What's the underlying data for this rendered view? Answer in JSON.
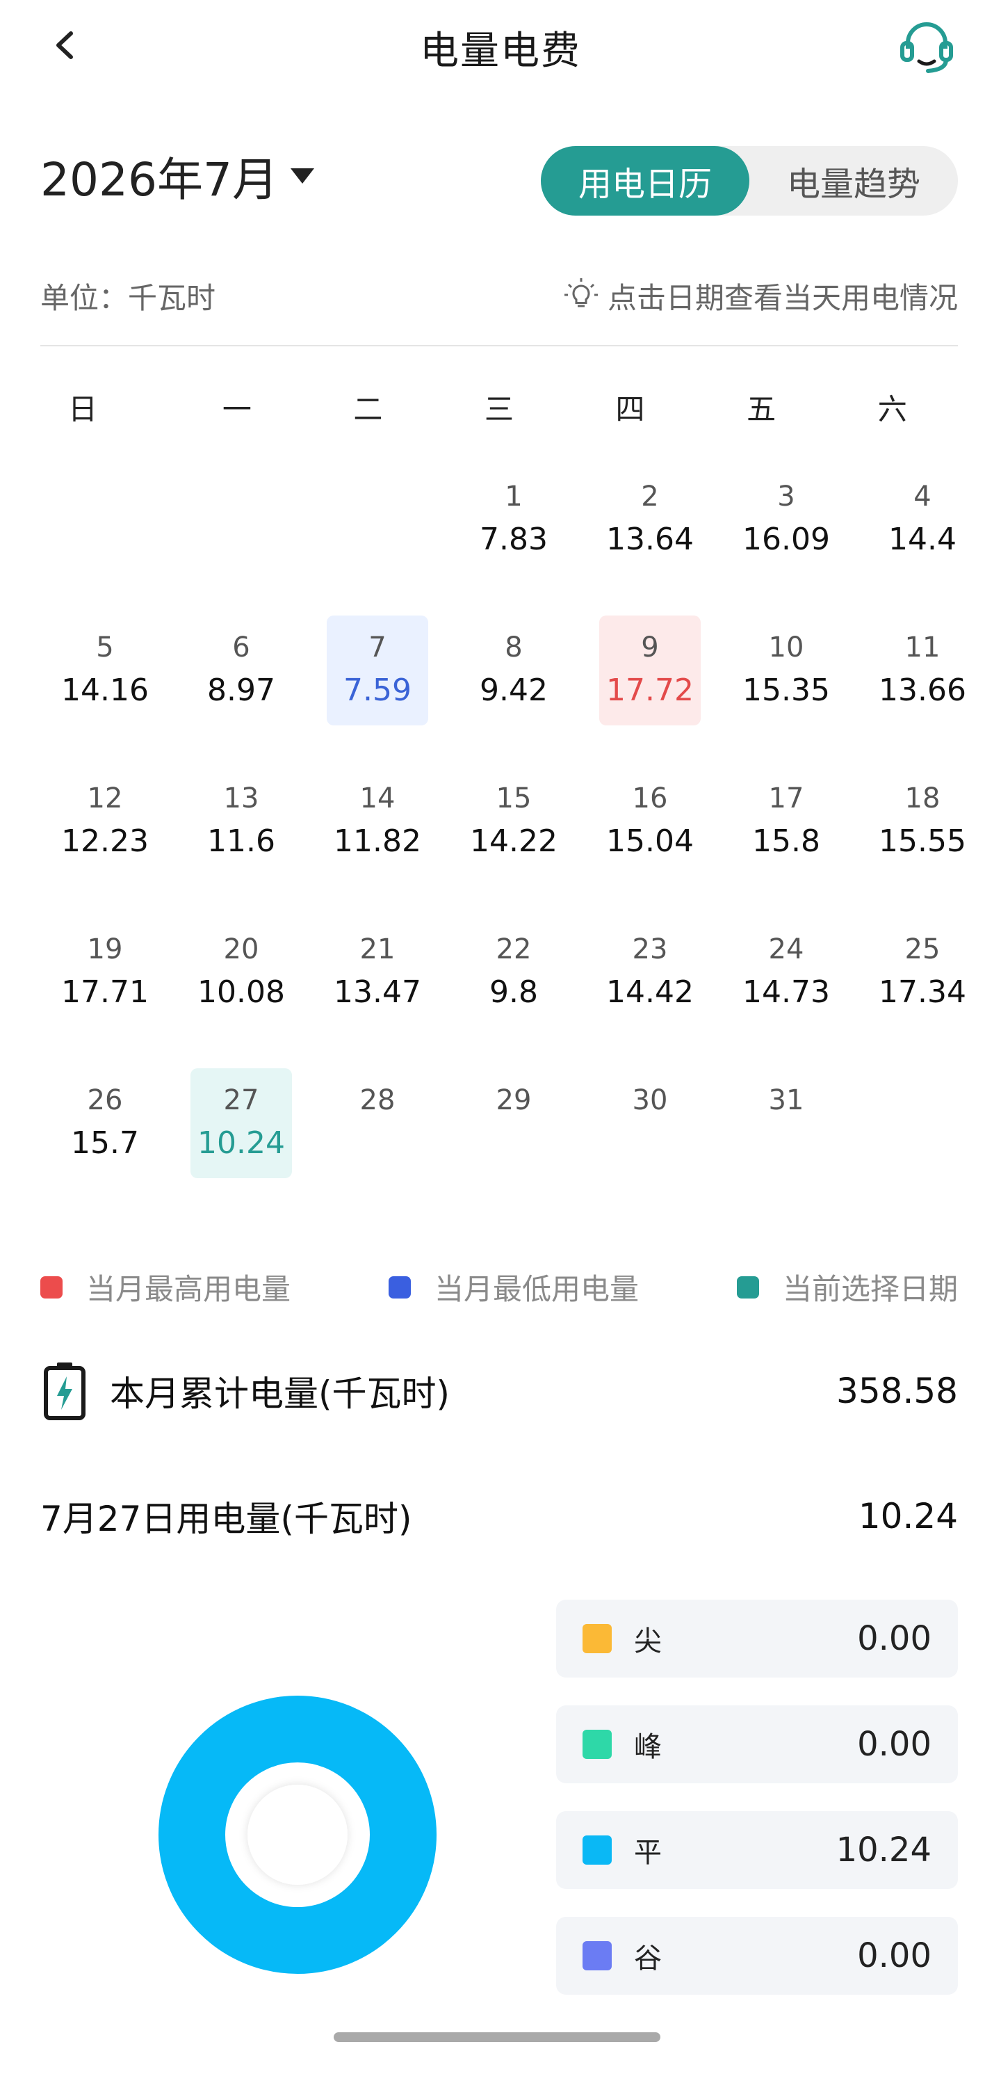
{
  "header": {
    "title": "电量电费",
    "back_icon": "chevron-left-icon",
    "service_icon": "headset-icon"
  },
  "month_picker": {
    "label": "2026年7月"
  },
  "tabs": [
    {
      "label": "用电日历",
      "active": true
    },
    {
      "label": "电量趋势",
      "active": false
    }
  ],
  "unit_label": "单位：千瓦时",
  "tip": {
    "icon": "lightbulb-icon",
    "text": "点击日期查看当天用电情况"
  },
  "weekdays": [
    "日",
    "一",
    "二",
    "三",
    "四",
    "五",
    "六"
  ],
  "calendar": {
    "first_weekday_index": 3,
    "days": [
      {
        "day": "1",
        "value": "7.83"
      },
      {
        "day": "2",
        "value": "13.64"
      },
      {
        "day": "3",
        "value": "16.09"
      },
      {
        "day": "4",
        "value": "14.4"
      },
      {
        "day": "5",
        "value": "14.16"
      },
      {
        "day": "6",
        "value": "8.97"
      },
      {
        "day": "7",
        "value": "7.59",
        "state": "low"
      },
      {
        "day": "8",
        "value": "9.42"
      },
      {
        "day": "9",
        "value": "17.72",
        "state": "high"
      },
      {
        "day": "10",
        "value": "15.35"
      },
      {
        "day": "11",
        "value": "13.66"
      },
      {
        "day": "12",
        "value": "12.23"
      },
      {
        "day": "13",
        "value": "11.6"
      },
      {
        "day": "14",
        "value": "11.82"
      },
      {
        "day": "15",
        "value": "14.22"
      },
      {
        "day": "16",
        "value": "15.04"
      },
      {
        "day": "17",
        "value": "15.8"
      },
      {
        "day": "18",
        "value": "15.55"
      },
      {
        "day": "19",
        "value": "17.71"
      },
      {
        "day": "20",
        "value": "10.08"
      },
      {
        "day": "21",
        "value": "13.47"
      },
      {
        "day": "22",
        "value": "9.8"
      },
      {
        "day": "23",
        "value": "14.42"
      },
      {
        "day": "24",
        "value": "14.73"
      },
      {
        "day": "25",
        "value": "17.34"
      },
      {
        "day": "26",
        "value": "15.7"
      },
      {
        "day": "27",
        "value": "10.24",
        "state": "selected"
      },
      {
        "day": "28",
        "value": ""
      },
      {
        "day": "29",
        "value": ""
      },
      {
        "day": "30",
        "value": ""
      },
      {
        "day": "31",
        "value": ""
      }
    ]
  },
  "legend": [
    {
      "label": "当月最高用电量",
      "color": "#ec4c4c"
    },
    {
      "label": "当月最低用电量",
      "color": "#3a5fe0"
    },
    {
      "label": "当前选择日期",
      "color": "#259c93"
    }
  ],
  "monthly_total": {
    "icon": "battery-charging-icon",
    "label": "本月累计电量(千瓦时)",
    "value": "358.58"
  },
  "daily_total": {
    "label": "7月27日用电量(千瓦时)",
    "value": "10.24"
  },
  "tou": [
    {
      "label": "尖",
      "value": "0.00",
      "color": "#fbb936"
    },
    {
      "label": "峰",
      "value": "0.00",
      "color": "#2ed8a8"
    },
    {
      "label": "平",
      "value": "10.24",
      "color": "#0ab8f5"
    },
    {
      "label": "谷",
      "value": "0.00",
      "color": "#6b7cf3"
    }
  ],
  "donut_color": "#06b9f7"
}
